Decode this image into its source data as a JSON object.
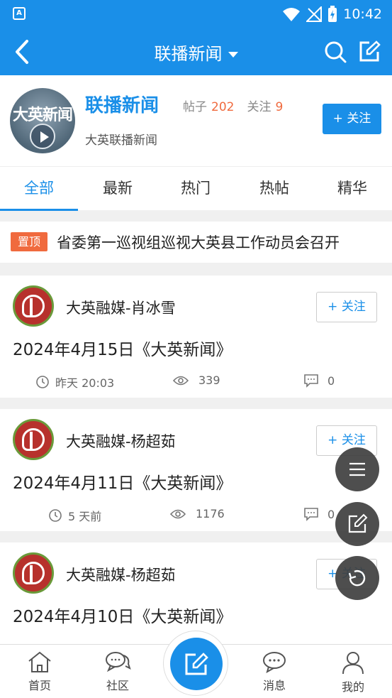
{
  "status_bar": {
    "time": "10:42",
    "app_icon": "A"
  },
  "navbar": {
    "title": "联播新闻",
    "icons": [
      "back-icon",
      "search-icon",
      "edit-icon"
    ]
  },
  "forum": {
    "logo_text": "大英新闻",
    "name": "联播新闻",
    "posts_label": "帖子",
    "posts_count": "202",
    "follow_label": "关注",
    "follow_count": "9",
    "description": "大英联播新闻",
    "follow_button": "+ 关注"
  },
  "tabs": [
    {
      "label": "全部",
      "active": true
    },
    {
      "label": "最新"
    },
    {
      "label": "热门"
    },
    {
      "label": "热帖"
    },
    {
      "label": "精华"
    }
  ],
  "pinned": {
    "badge": "置顶",
    "title": "省委第一巡视组巡视大英县工作动员会召开"
  },
  "posts": [
    {
      "author": "大英融媒-肖冰雪",
      "follow": "+ 关注",
      "title": "2024年4月15日《大英新闻》",
      "time": "昨天 20:03",
      "views": "339",
      "comments": "0"
    },
    {
      "author": "大英融媒-杨超茹",
      "follow": "+ 关注",
      "title": "2024年4月11日《大英新闻》",
      "time": "5 天前",
      "views": "1176",
      "comments": "0"
    },
    {
      "author": "大英融媒-杨超茹",
      "follow": "+ 关注",
      "title": "2024年4月10日《大英新闻》",
      "time": "",
      "views": "",
      "comments": ""
    }
  ],
  "floating_actions": [
    "menu-icon",
    "compose-icon",
    "refresh-icon"
  ],
  "bottom_nav": [
    {
      "label": "首页",
      "icon": "home-icon"
    },
    {
      "label": "社区",
      "icon": "community-icon"
    },
    {
      "label": "",
      "icon": "compose-icon"
    },
    {
      "label": "消息",
      "icon": "message-icon"
    },
    {
      "label": "我的",
      "icon": "profile-icon"
    }
  ],
  "colors": {
    "primary": "#1a8fe8",
    "accent": "#f06a3e"
  }
}
